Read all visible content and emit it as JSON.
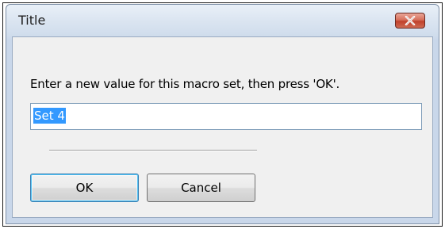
{
  "window": {
    "title": "Title",
    "close_icon": "close-icon"
  },
  "dialog": {
    "prompt": "Enter a new value for this macro set, then press 'OK'.",
    "input_value": "Set 4"
  },
  "buttons": {
    "ok_label": "OK",
    "cancel_label": "Cancel"
  },
  "colors": {
    "selection": "#3399ff",
    "close_button": "#c0412b",
    "client_background": "#f0f0f0"
  }
}
